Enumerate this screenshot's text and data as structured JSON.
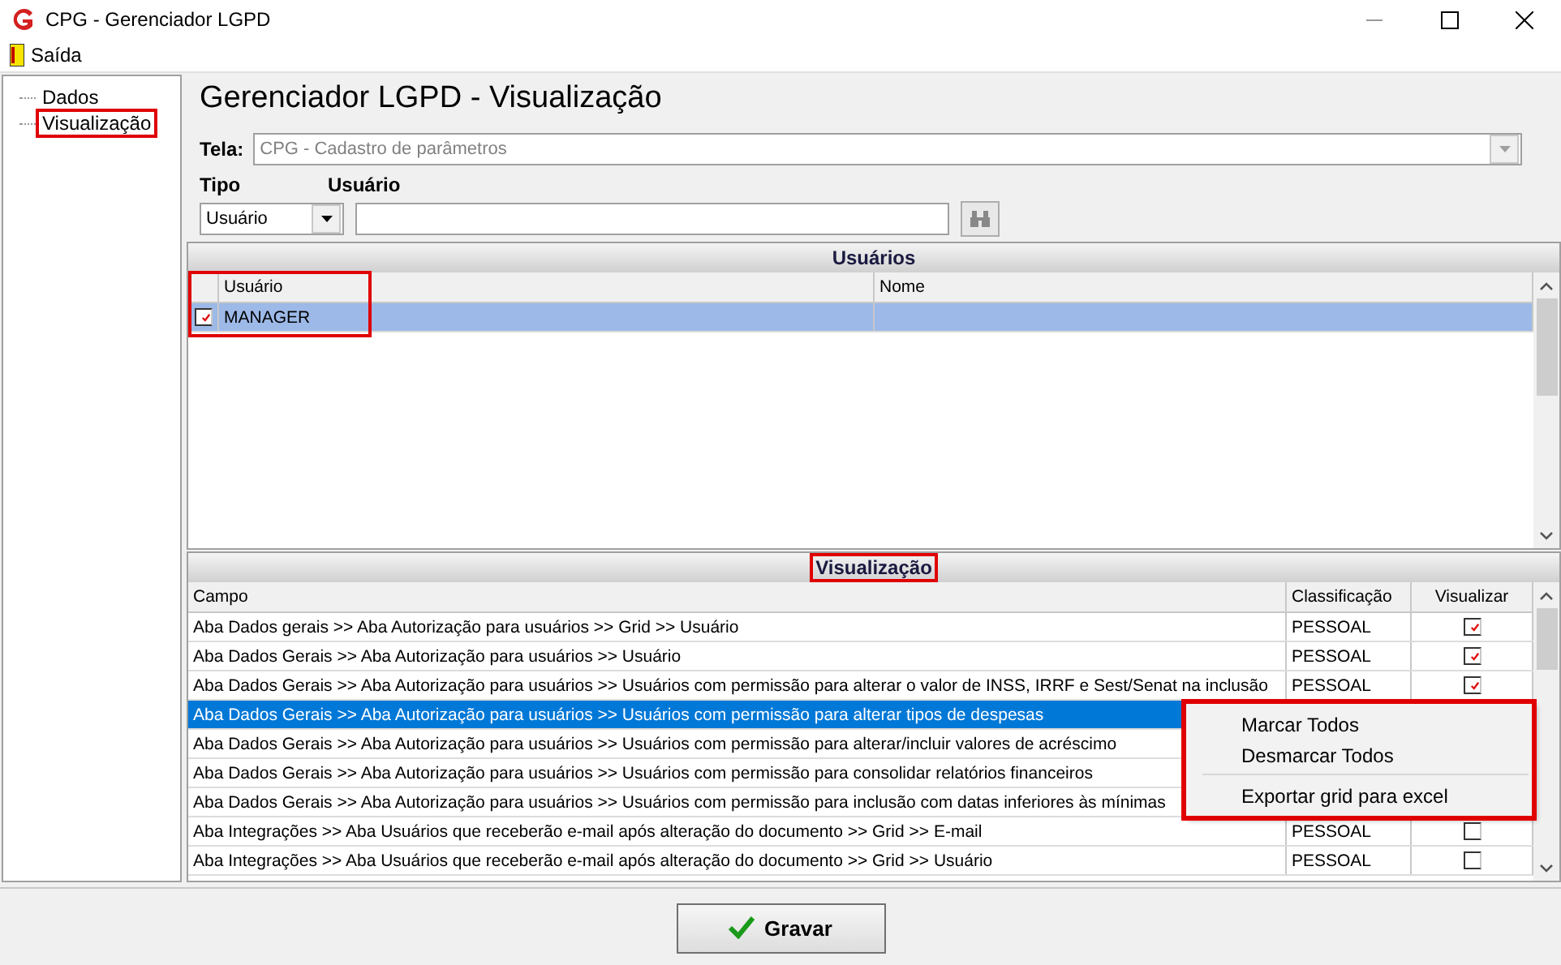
{
  "window": {
    "title": "CPG - Gerenciador LGPD"
  },
  "menu": [
    {
      "label": "Saída"
    }
  ],
  "tree": {
    "items": [
      {
        "label": "Dados",
        "highlighted": false
      },
      {
        "label": "Visualização",
        "highlighted": true
      }
    ]
  },
  "heading": "Gerenciador LGPD - Visualização",
  "tela": {
    "label": "Tela:",
    "value": "CPG - Cadastro de parâmetros",
    "disabled": true
  },
  "tipo": {
    "label": "Tipo",
    "value": "Usuário"
  },
  "usuario": {
    "label": "Usuário"
  },
  "users_grid": {
    "title": "Usuários",
    "highlighted": true,
    "columns": [
      "Usuário",
      "Nome"
    ],
    "rows": [
      {
        "checked": true,
        "selected": true,
        "usuario": "MANAGER"
      }
    ]
  },
  "fields_grid": {
    "title": "Visualização",
    "title_highlighted": true,
    "columns": [
      "Campo",
      "Classificação",
      "Visualizar"
    ],
    "rows": [
      {
        "campo": "Aba Dados gerais >> Aba Autorização para usuários >> Grid >> Usuário",
        "classificacao": "PESSOAL",
        "visualizar": true,
        "selected": false
      },
      {
        "campo": "Aba Dados Gerais >> Aba Autorização para usuários >> Usuário",
        "classificacao": "PESSOAL",
        "visualizar": true,
        "selected": false
      },
      {
        "campo": "Aba Dados Gerais >> Aba Autorização para usuários >> Usuários com permissão para alterar o valor de INSS, IRRF e Sest/Senat na inclusão",
        "classificacao": "PESSOAL",
        "visualizar": true,
        "selected": false
      },
      {
        "campo": "Aba Dados Gerais >> Aba Autorização para usuários >> Usuários com permissão para alterar tipos de despesas",
        "selected": true
      },
      {
        "campo": "Aba Dados Gerais >> Aba Autorização para usuários >> Usuários com permissão para alterar/incluir valores de acréscimo",
        "selected": false
      },
      {
        "campo": "Aba Dados Gerais >> Aba Autorização para usuários >> Usuários com permissão para consolidar relatórios financeiros",
        "selected": false
      },
      {
        "campo": "Aba Dados Gerais >> Aba Autorização para usuários >> Usuários com permissão para inclusão com datas inferiores às mínimas",
        "selected": false
      },
      {
        "campo": "Aba Integrações  >> Aba Usuários que receberão e-mail após alteração do documento >> Grid >> E-mail",
        "classificacao": "PESSOAL",
        "visualizar": false,
        "selected": false
      },
      {
        "campo": "Aba Integrações  >> Aba Usuários que receberão e-mail após alteração do documento >> Grid >> Usuário",
        "classificacao": "PESSOAL",
        "visualizar": false,
        "selected": false
      }
    ]
  },
  "context_menu": {
    "highlighted": true,
    "items": [
      {
        "kind": "item",
        "label": "Marcar Todos"
      },
      {
        "kind": "item",
        "label": "Desmarcar Todos"
      },
      {
        "kind": "separator"
      },
      {
        "kind": "item",
        "label": "Exportar grid para excel"
      }
    ]
  },
  "buttons": [
    {
      "label": "Gravar"
    }
  ]
}
